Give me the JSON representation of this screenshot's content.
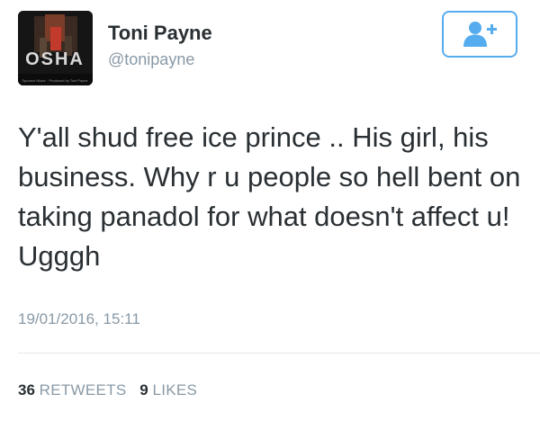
{
  "user": {
    "display_name": "Toni Payne",
    "handle": "@tonipayne"
  },
  "avatar": {
    "logo_text": "OSHA",
    "caption": "Sponsor Music · Produced by Toni Payne"
  },
  "follow_button": {
    "icon": "add-user-icon",
    "color": "#55acee"
  },
  "tweet": {
    "text": "Y'all shud free ice prince .. His girl, his business. Why r u people so hell bent on taking panadol for what doesn't affect u! Ugggh",
    "timestamp": "19/01/2016, 15:11"
  },
  "stats": {
    "retweets_count": "36",
    "retweets_label": "RETWEETS",
    "likes_count": "9",
    "likes_label": "LIKES"
  },
  "colors": {
    "text": "#292f33",
    "secondary": "#8899a6",
    "accent": "#55acee",
    "divider": "#e1e8ed"
  }
}
